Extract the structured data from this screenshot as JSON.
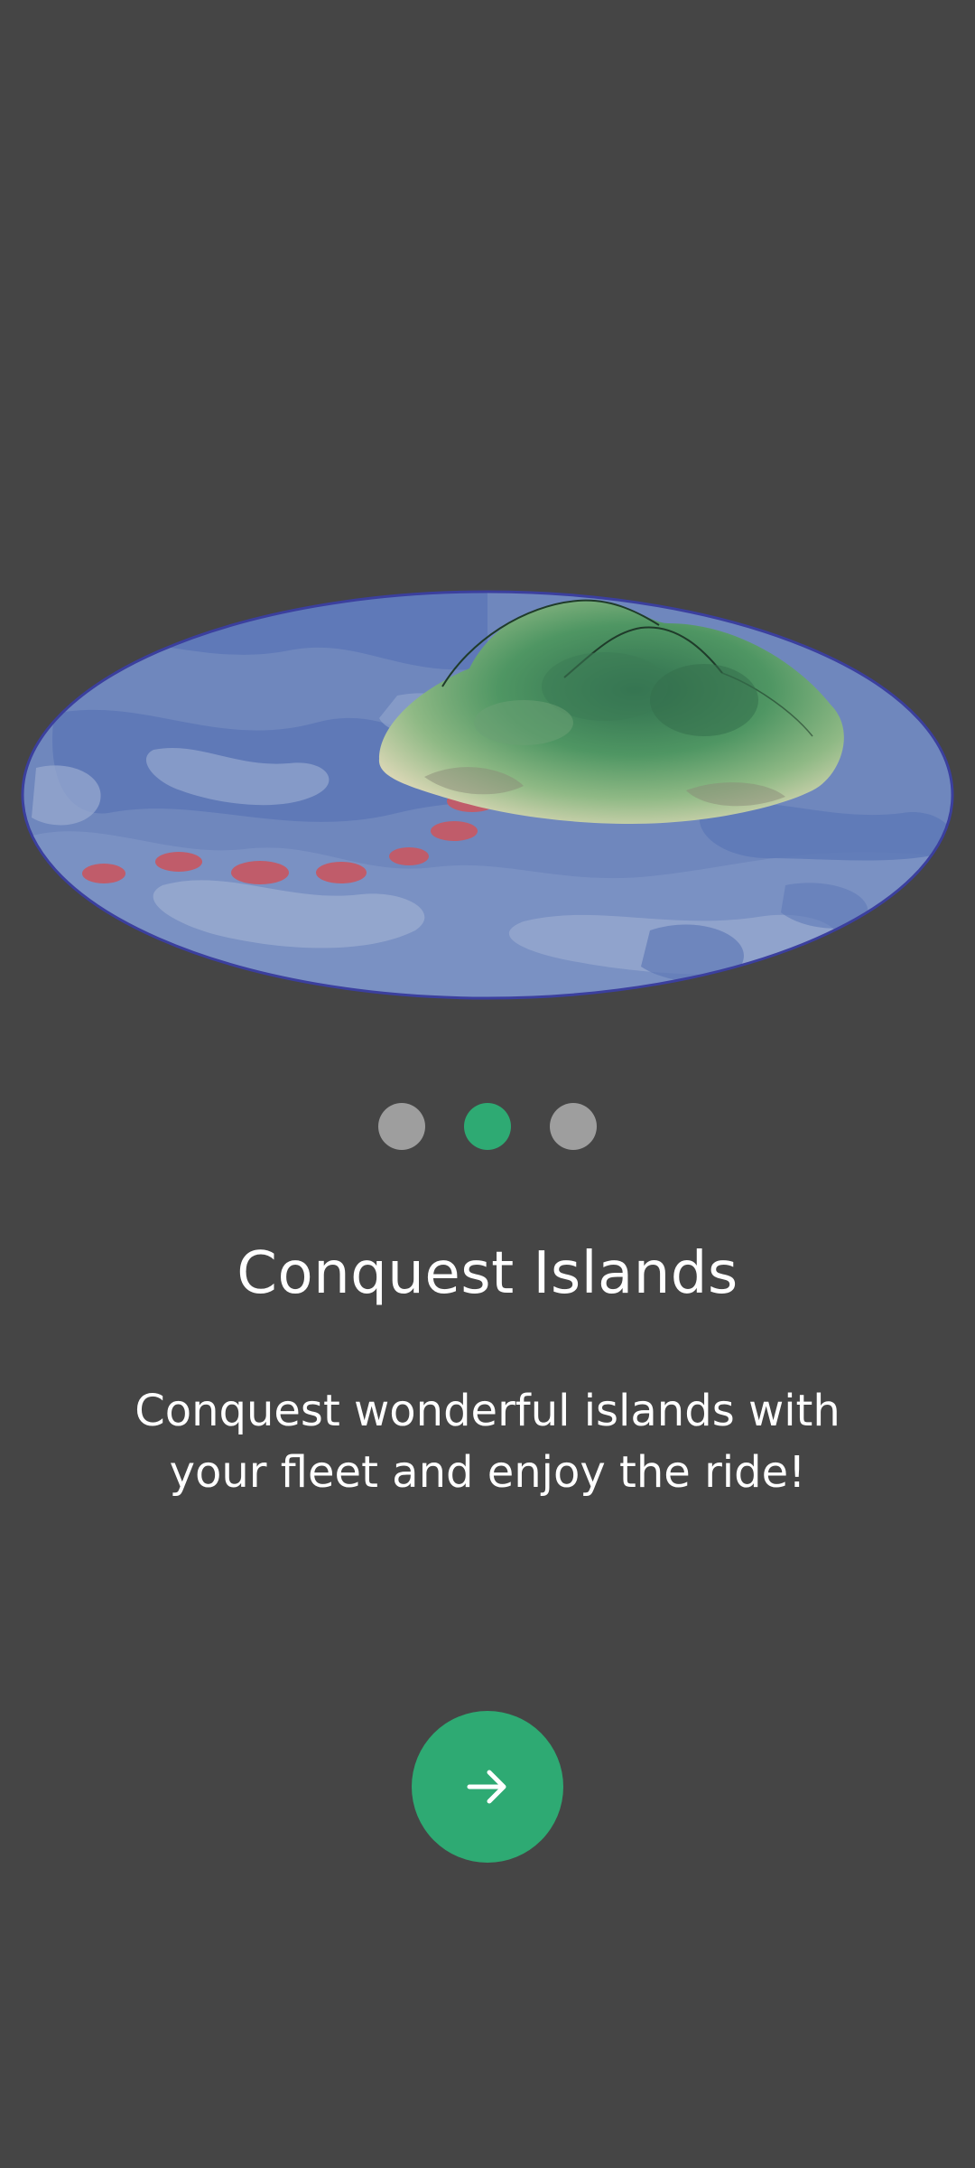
{
  "onboarding": {
    "illustration_icon": "island-map-illustration",
    "pager": {
      "count": 3,
      "active_index": 1
    },
    "title": "Conquest Islands",
    "description": "Conquest wonderful islands with your fleet and enjoy the ride!",
    "next_button_icon": "arrow-right-icon"
  },
  "colors": {
    "background": "#454545",
    "accent": "#2eaa73",
    "dot_inactive": "#9e9e9e",
    "text": "#ffffff"
  }
}
